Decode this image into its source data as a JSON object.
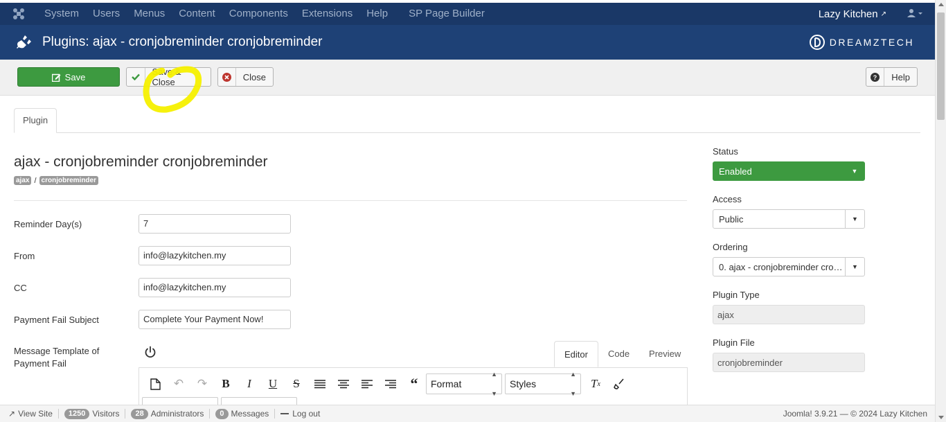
{
  "topnav": {
    "menu": [
      "System",
      "Users",
      "Menus",
      "Content",
      "Components",
      "Extensions",
      "Help",
      "SP Page Builder"
    ],
    "site_name": "Lazy Kitchen",
    "icons": {
      "logo": "joomla-logo-icon",
      "external": "external-link-icon",
      "user": "user-icon"
    }
  },
  "header": {
    "title": "Plugins: ajax - cronjobreminder cronjobreminder",
    "brand": "DREAMZTECH"
  },
  "toolbar": {
    "save_label": "Save",
    "save_close_label": "Save & Close",
    "close_label": "Close",
    "help_label": "Help"
  },
  "tabs": {
    "plugin": "Plugin"
  },
  "plugin": {
    "title": "ajax - cronjobreminder cronjobreminder",
    "badge_group": "ajax",
    "badge_sep": "/",
    "badge_element": "cronjobreminder"
  },
  "fields": {
    "reminder_label": "Reminder Day(s)",
    "reminder_value": "7",
    "from_label": "From",
    "from_value": "info@lazykitchen.my",
    "cc_label": "CC",
    "cc_value": "info@lazykitchen.my",
    "subject_label": "Payment Fail Subject",
    "subject_value": "Complete Your Payment Now!",
    "template_label": "Message Template of Payment Fail"
  },
  "editor": {
    "tabs": [
      "Editor",
      "Code",
      "Preview"
    ],
    "format": "Format",
    "styles": "Styles"
  },
  "sidebar": {
    "status_label": "Status",
    "status_value": "Enabled",
    "access_label": "Access",
    "access_value": "Public",
    "ordering_label": "Ordering",
    "ordering_value": "0. ajax - cronjobreminder cro…",
    "type_label": "Plugin Type",
    "type_value": "ajax",
    "file_label": "Plugin File",
    "file_value": "cronjobreminder"
  },
  "footer": {
    "view_site": "View Site",
    "visitors_count": "1250",
    "visitors": "Visitors",
    "admins_count": "28",
    "admins": "Administrators",
    "messages_count": "0",
    "messages": "Messages",
    "logout": "Log out",
    "version": "Joomla! 3.9.21  —  © 2024 Lazy Kitchen"
  },
  "colors": {
    "topnav": "#1a3867",
    "header": "#1e4176",
    "success": "#3d9a40",
    "highlight": "#f5f000"
  }
}
